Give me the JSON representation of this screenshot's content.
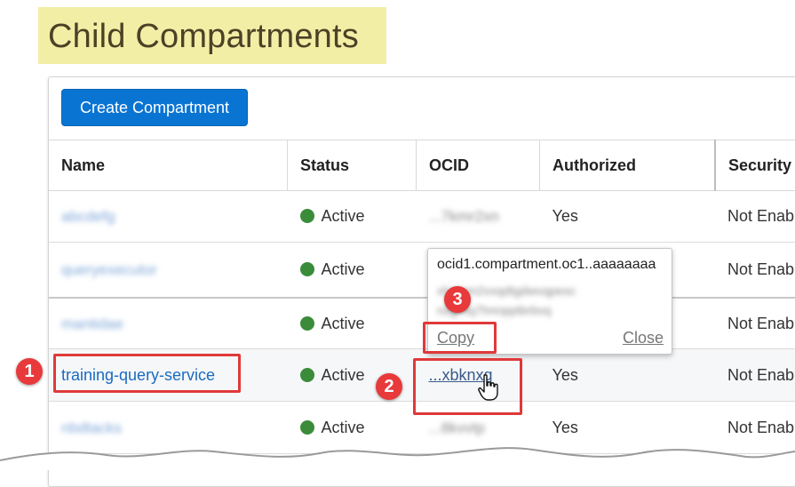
{
  "page": {
    "title": "Child Compartments"
  },
  "toolbar": {
    "create_label": "Create Compartment"
  },
  "table": {
    "headers": {
      "name": "Name",
      "status": "Status",
      "ocid": "OCID",
      "authorized": "Authorized",
      "security": "Security"
    },
    "rows": [
      {
        "name": "abcdefg",
        "status": "Active",
        "ocid": "...7kmr2xn",
        "authorized": "Yes",
        "security": "Not Enab"
      },
      {
        "name": "queryexecutor",
        "status": "Active",
        "ocid": "",
        "authorized": "",
        "security": "Not Enab"
      },
      {
        "name": "mantidae",
        "status": "Active",
        "ocid": "",
        "authorized": "",
        "security": "Not Enab"
      },
      {
        "name": "training-query-service",
        "status": "Active",
        "ocid": "...xbknxq",
        "authorized": "Yes",
        "security": "Not Enab"
      },
      {
        "name": "nbdtacks",
        "status": "Active",
        "ocid": "...8kvvtp",
        "authorized": "Yes",
        "security": "Not Enab"
      }
    ]
  },
  "popover": {
    "ocid_text": "ocid1.compartment.oc1..aaaaaaaa",
    "blur_line_1": "xhxmm2vxqdtgdwvqpesc",
    "blur_line_2": "nsgrhq7hnnpptbrbvq",
    "copy_label": "Copy",
    "close_label": "Close"
  },
  "callouts": {
    "one": "1",
    "two": "2",
    "three": "3"
  },
  "colors": {
    "accent": "#0a74d3",
    "highlight": "#e0393a",
    "active": "#3a8c3a",
    "title_bg": "#f3eea6"
  }
}
